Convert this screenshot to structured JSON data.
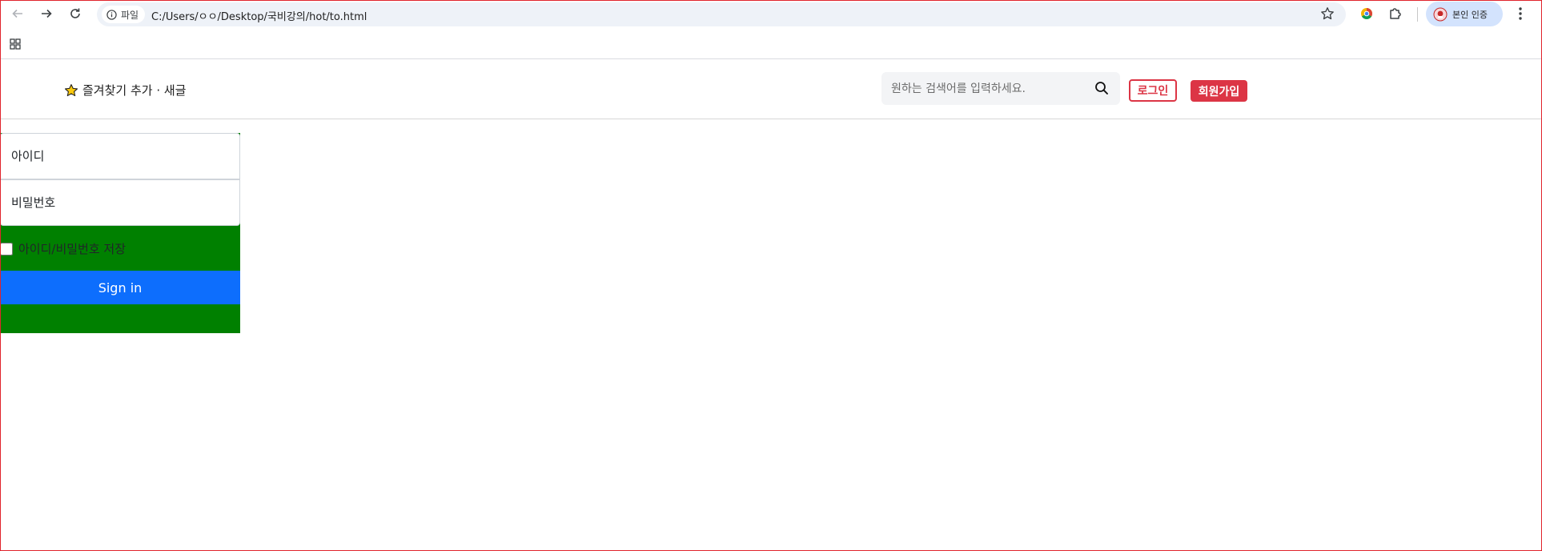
{
  "browser": {
    "chip_label": "파일",
    "url": "C:/Users/ㅇㅇ/Desktop/국비강의/hot/to.html",
    "profile_label": "본인 인증",
    "icons": {
      "back": "arrow-left-icon",
      "forward": "arrow-right-icon",
      "reload": "reload-icon",
      "info": "info-icon",
      "bookmark_star": "star-outline-icon",
      "extension_colorful": "colorful-extension-icon",
      "extensions": "puzzle-icon",
      "menu": "kebab-menu-icon",
      "apps": "apps-grid-icon"
    }
  },
  "header": {
    "favorites_label": "즐겨찾기 추가 · 새글",
    "search_placeholder": "원하는 검색어를 입력하세요.",
    "login_label": "로그인",
    "join_label": "회원가입",
    "colors": {
      "accent_red": "#dc3545"
    }
  },
  "login": {
    "id_placeholder": "아이디",
    "pw_placeholder": "비밀번호",
    "remember_label": "아이디/비밀번호 저장",
    "remember_checked": false,
    "signin_label": "Sign in",
    "colors": {
      "panel_bg": "#008000",
      "button_bg": "#0d6efd"
    }
  }
}
